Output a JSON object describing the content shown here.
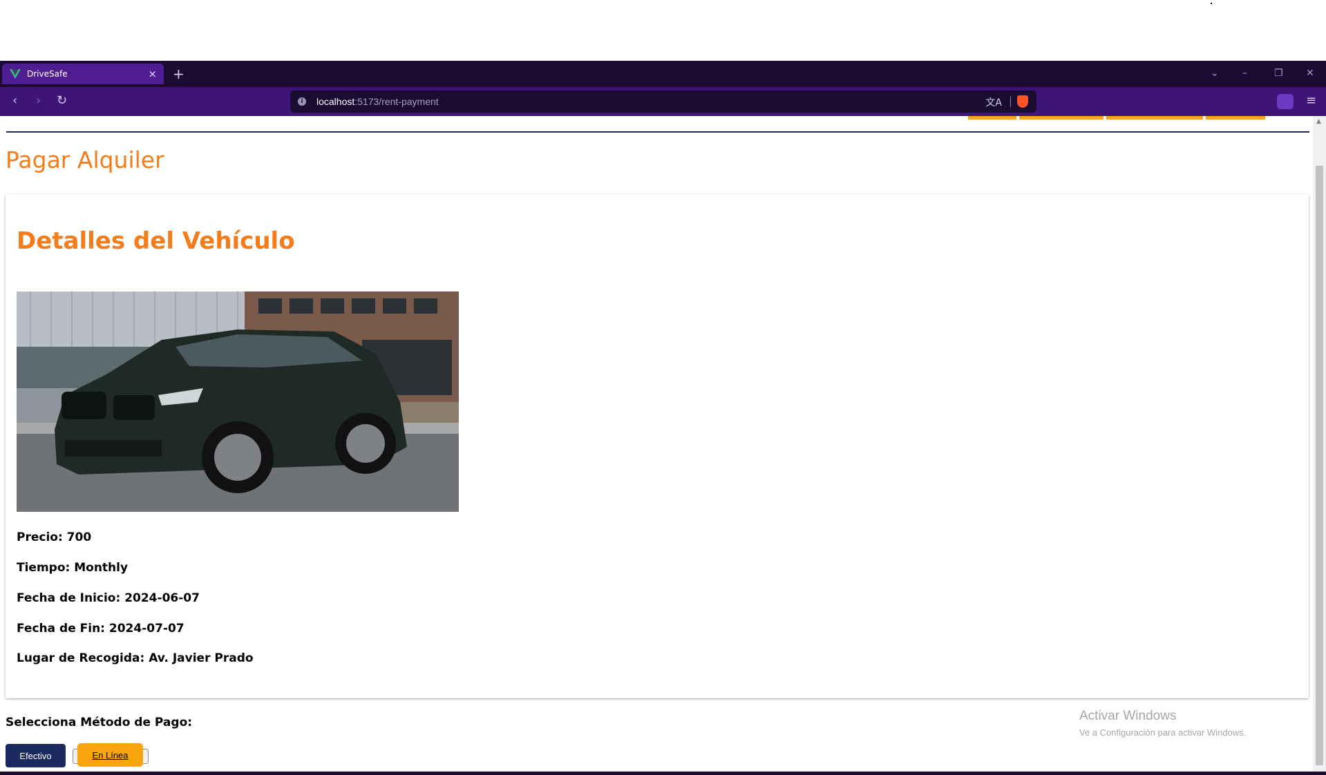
{
  "browser": {
    "tab_title": "DriveSafe",
    "tab_close": "×",
    "new_tab": "+",
    "url_host": "localhost",
    "url_path": ":5173/rent-payment",
    "window_controls": [
      "⌄",
      "–",
      "❐",
      "✕"
    ],
    "nav": {
      "back": "‹",
      "forward": "›",
      "reload": "↻"
    },
    "menu": "≡"
  },
  "page": {
    "title": "Pagar Alquiler"
  },
  "vehicle": {
    "section_title": "Detalles del Vehículo",
    "image_alt": "BMW X5 SUV",
    "details": [
      "Precio: 700",
      "Tiempo: Monthly",
      "Fecha de Inicio: 2024-06-07",
      "Fecha de Fin: 2024-07-07",
      "Lugar de Recogida: Av. Javier Prado"
    ]
  },
  "payment": {
    "label": "Selecciona Método de Pago:",
    "cash_button": "Efectivo",
    "online_button": "En Línea"
  },
  "watermark": {
    "title": "Activar Windows",
    "subtitle": "Ve a Configuración para activar Windows."
  },
  "colors": {
    "accent_orange": "#f47c1a",
    "button_navy": "#1b2a5e",
    "button_yellow": "#f9a50f",
    "browser_purple": "#3c1576"
  }
}
